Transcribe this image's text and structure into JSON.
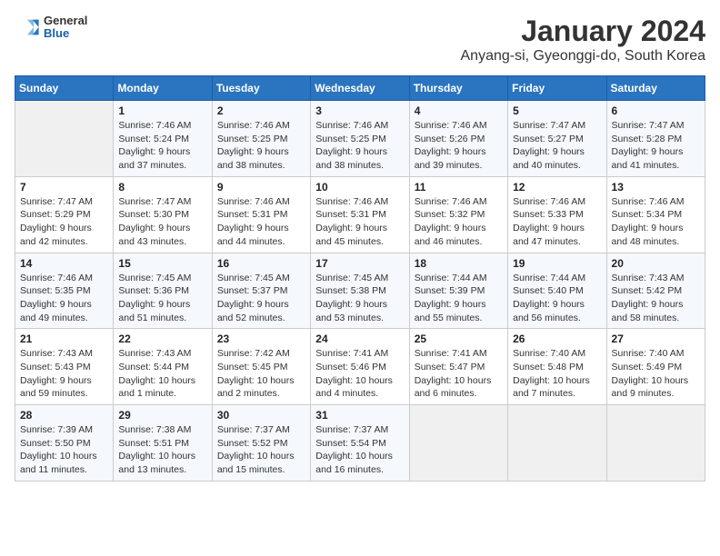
{
  "logo": {
    "line1": "General",
    "line2": "Blue"
  },
  "title": "January 2024",
  "subtitle": "Anyang-si, Gyeonggi-do, South Korea",
  "weekdays": [
    "Sunday",
    "Monday",
    "Tuesday",
    "Wednesday",
    "Thursday",
    "Friday",
    "Saturday"
  ],
  "weeks": [
    [
      {
        "day": "",
        "sunrise": "",
        "sunset": "",
        "daylight": ""
      },
      {
        "day": "1",
        "sunrise": "Sunrise: 7:46 AM",
        "sunset": "Sunset: 5:24 PM",
        "daylight": "Daylight: 9 hours and 37 minutes."
      },
      {
        "day": "2",
        "sunrise": "Sunrise: 7:46 AM",
        "sunset": "Sunset: 5:25 PM",
        "daylight": "Daylight: 9 hours and 38 minutes."
      },
      {
        "day": "3",
        "sunrise": "Sunrise: 7:46 AM",
        "sunset": "Sunset: 5:25 PM",
        "daylight": "Daylight: 9 hours and 38 minutes."
      },
      {
        "day": "4",
        "sunrise": "Sunrise: 7:46 AM",
        "sunset": "Sunset: 5:26 PM",
        "daylight": "Daylight: 9 hours and 39 minutes."
      },
      {
        "day": "5",
        "sunrise": "Sunrise: 7:47 AM",
        "sunset": "Sunset: 5:27 PM",
        "daylight": "Daylight: 9 hours and 40 minutes."
      },
      {
        "day": "6",
        "sunrise": "Sunrise: 7:47 AM",
        "sunset": "Sunset: 5:28 PM",
        "daylight": "Daylight: 9 hours and 41 minutes."
      }
    ],
    [
      {
        "day": "7",
        "sunrise": "Sunrise: 7:47 AM",
        "sunset": "Sunset: 5:29 PM",
        "daylight": "Daylight: 9 hours and 42 minutes."
      },
      {
        "day": "8",
        "sunrise": "Sunrise: 7:47 AM",
        "sunset": "Sunset: 5:30 PM",
        "daylight": "Daylight: 9 hours and 43 minutes."
      },
      {
        "day": "9",
        "sunrise": "Sunrise: 7:46 AM",
        "sunset": "Sunset: 5:31 PM",
        "daylight": "Daylight: 9 hours and 44 minutes."
      },
      {
        "day": "10",
        "sunrise": "Sunrise: 7:46 AM",
        "sunset": "Sunset: 5:31 PM",
        "daylight": "Daylight: 9 hours and 45 minutes."
      },
      {
        "day": "11",
        "sunrise": "Sunrise: 7:46 AM",
        "sunset": "Sunset: 5:32 PM",
        "daylight": "Daylight: 9 hours and 46 minutes."
      },
      {
        "day": "12",
        "sunrise": "Sunrise: 7:46 AM",
        "sunset": "Sunset: 5:33 PM",
        "daylight": "Daylight: 9 hours and 47 minutes."
      },
      {
        "day": "13",
        "sunrise": "Sunrise: 7:46 AM",
        "sunset": "Sunset: 5:34 PM",
        "daylight": "Daylight: 9 hours and 48 minutes."
      }
    ],
    [
      {
        "day": "14",
        "sunrise": "Sunrise: 7:46 AM",
        "sunset": "Sunset: 5:35 PM",
        "daylight": "Daylight: 9 hours and 49 minutes."
      },
      {
        "day": "15",
        "sunrise": "Sunrise: 7:45 AM",
        "sunset": "Sunset: 5:36 PM",
        "daylight": "Daylight: 9 hours and 51 minutes."
      },
      {
        "day": "16",
        "sunrise": "Sunrise: 7:45 AM",
        "sunset": "Sunset: 5:37 PM",
        "daylight": "Daylight: 9 hours and 52 minutes."
      },
      {
        "day": "17",
        "sunrise": "Sunrise: 7:45 AM",
        "sunset": "Sunset: 5:38 PM",
        "daylight": "Daylight: 9 hours and 53 minutes."
      },
      {
        "day": "18",
        "sunrise": "Sunrise: 7:44 AM",
        "sunset": "Sunset: 5:39 PM",
        "daylight": "Daylight: 9 hours and 55 minutes."
      },
      {
        "day": "19",
        "sunrise": "Sunrise: 7:44 AM",
        "sunset": "Sunset: 5:40 PM",
        "daylight": "Daylight: 9 hours and 56 minutes."
      },
      {
        "day": "20",
        "sunrise": "Sunrise: 7:43 AM",
        "sunset": "Sunset: 5:42 PM",
        "daylight": "Daylight: 9 hours and 58 minutes."
      }
    ],
    [
      {
        "day": "21",
        "sunrise": "Sunrise: 7:43 AM",
        "sunset": "Sunset: 5:43 PM",
        "daylight": "Daylight: 9 hours and 59 minutes."
      },
      {
        "day": "22",
        "sunrise": "Sunrise: 7:43 AM",
        "sunset": "Sunset: 5:44 PM",
        "daylight": "Daylight: 10 hours and 1 minute."
      },
      {
        "day": "23",
        "sunrise": "Sunrise: 7:42 AM",
        "sunset": "Sunset: 5:45 PM",
        "daylight": "Daylight: 10 hours and 2 minutes."
      },
      {
        "day": "24",
        "sunrise": "Sunrise: 7:41 AM",
        "sunset": "Sunset: 5:46 PM",
        "daylight": "Daylight: 10 hours and 4 minutes."
      },
      {
        "day": "25",
        "sunrise": "Sunrise: 7:41 AM",
        "sunset": "Sunset: 5:47 PM",
        "daylight": "Daylight: 10 hours and 6 minutes."
      },
      {
        "day": "26",
        "sunrise": "Sunrise: 7:40 AM",
        "sunset": "Sunset: 5:48 PM",
        "daylight": "Daylight: 10 hours and 7 minutes."
      },
      {
        "day": "27",
        "sunrise": "Sunrise: 7:40 AM",
        "sunset": "Sunset: 5:49 PM",
        "daylight": "Daylight: 10 hours and 9 minutes."
      }
    ],
    [
      {
        "day": "28",
        "sunrise": "Sunrise: 7:39 AM",
        "sunset": "Sunset: 5:50 PM",
        "daylight": "Daylight: 10 hours and 11 minutes."
      },
      {
        "day": "29",
        "sunrise": "Sunrise: 7:38 AM",
        "sunset": "Sunset: 5:51 PM",
        "daylight": "Daylight: 10 hours and 13 minutes."
      },
      {
        "day": "30",
        "sunrise": "Sunrise: 7:37 AM",
        "sunset": "Sunset: 5:52 PM",
        "daylight": "Daylight: 10 hours and 15 minutes."
      },
      {
        "day": "31",
        "sunrise": "Sunrise: 7:37 AM",
        "sunset": "Sunset: 5:54 PM",
        "daylight": "Daylight: 10 hours and 16 minutes."
      },
      {
        "day": "",
        "sunrise": "",
        "sunset": "",
        "daylight": ""
      },
      {
        "day": "",
        "sunrise": "",
        "sunset": "",
        "daylight": ""
      },
      {
        "day": "",
        "sunrise": "",
        "sunset": "",
        "daylight": ""
      }
    ]
  ]
}
